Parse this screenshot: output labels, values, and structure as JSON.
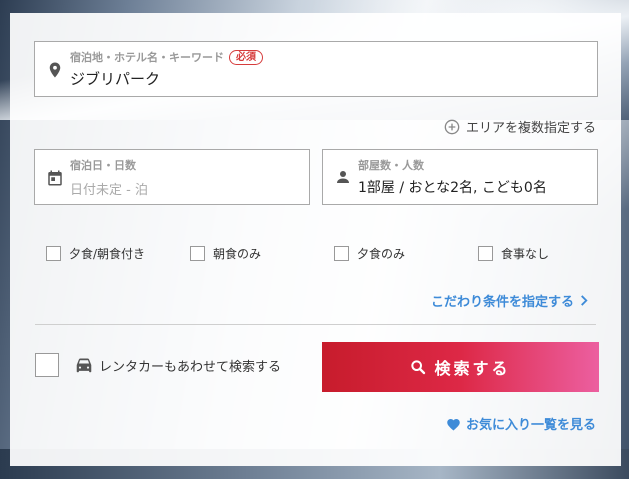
{
  "destination": {
    "label": "宿泊地・ホテル名・キーワード",
    "required_badge": "必須",
    "value": "ジブリパーク"
  },
  "add_area_link": "エリアを複数指定する",
  "dates": {
    "label": "宿泊日・日数",
    "placeholder": "日付未定 - 泊"
  },
  "guests": {
    "label": "部屋数・人数",
    "value": "1部屋 / おとな2名, こども0名"
  },
  "meals": [
    {
      "label": "夕食/朝食付き"
    },
    {
      "label": "朝食のみ"
    },
    {
      "label": "夕食のみ"
    },
    {
      "label": "食事なし"
    }
  ],
  "conditions_link": "こだわり条件を指定する",
  "rental_car_label": "レンタカーもあわせて検索する",
  "search_button_label": "検索する",
  "favorites_link": "お気に入り一覧を見る",
  "colors": {
    "accent_blue": "#3e8bd8",
    "search_gradient_start": "#c71c2c",
    "search_gradient_end": "#ec5fa0",
    "required_red": "#d63c3c"
  }
}
